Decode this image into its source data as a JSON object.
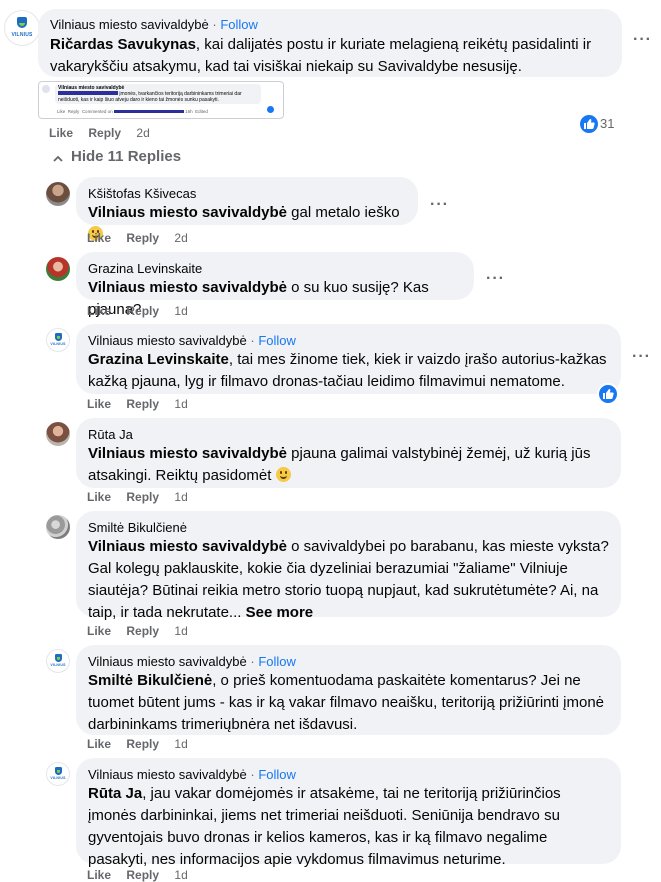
{
  "top_post": {
    "author": "Vilniaus miesto savivaldybė",
    "follow": "Follow",
    "separator": "·",
    "mention": "Ričardas Savukynas",
    "text": ", kai dalijatės postu ir kuriate melagieną reikėtų pasidalinti ir vakarykščiu atsakymu, kad tai visiškai niekaip su Savivaldybe nesusiję.",
    "avatar_brand": "VILNIUS",
    "actions": {
      "like": "Like",
      "reply": "Reply",
      "time": "2d"
    },
    "reaction_count": "31",
    "embedded_screenshot": {
      "author": "Vilniaus miesto savivaldybė",
      "line1": "įmonės, tvarkančios teritoriją darbininkams trimeriai dar",
      "line2": "neišduoti, kas ir kaip šiuo atveju daro ir kieno tai žmonės sunku pasakyti.",
      "like": "Like",
      "reply": "Reply",
      "commented_on": "Commented on",
      "time": "16h",
      "edited": "Edited"
    }
  },
  "hide_replies": "Hide 11 Replies",
  "replies": [
    {
      "author": "Kšištofas Kšivecas",
      "mention": "Vilniaus miesto savivaldybė",
      "text": " gal metalo ieško ",
      "emoji": "grin",
      "like": "Like",
      "reply": "Reply",
      "time": "2d"
    },
    {
      "author": "Grazina Levinskaite",
      "mention": "Vilniaus miesto savivaldybė",
      "text": " o su kuo susiję? Kas pjauna?",
      "like": "Like",
      "reply": "Reply",
      "time": "1d"
    },
    {
      "author": "Vilniaus miesto savivaldybė",
      "follow": "Follow",
      "mention": "Grazina Levinskaite",
      "text": ", tai mes žinome tiek, kiek ir vaizdo įrašo autorius-kažkas kažką pjauna, lyg ir filmavo dronas-tačiau leidimo filmavimui nematome.",
      "like": "Like",
      "reply": "Reply",
      "time": "1d"
    },
    {
      "author": "Rūta Ja",
      "mention": "Vilniaus miesto savivaldybė",
      "text": " pjauna galimai valstybinėj žemėj, už kurią jūs atsakingi. Reiktų pasidomėt ",
      "emoji": "smile",
      "like": "Like",
      "reply": "Reply",
      "time": "1d"
    },
    {
      "author": "Smiltė Bikulčienė",
      "mention": "Vilniaus miesto savivaldybė",
      "text": " o savivaldybei po barabanu, kas mieste vyksta? Gal kolegų paklauskite, kokie čia dyzeliniai berazumiai \"žaliame\" Vilniuje siautėja? Būtinai reikia metro storio tuopą nupjaut, kad sukrutėtumėte? Ai, na taip, ir tada nekrutate... ",
      "see_more": "See more",
      "like": "Like",
      "reply": "Reply",
      "time": "1d"
    },
    {
      "author": "Vilniaus miesto savivaldybė",
      "follow": "Follow",
      "mention": "Smiltė Bikulčienė",
      "text": ", o prieš komentuodama paskaitėte komentarus? Jei ne tuomet būtent jums - kas ir ką vakar filmavo neaišku, teritoriją prižiūrinti įmonė darbininkams trimeriųbnėra net išdavusi.",
      "like": "Like",
      "reply": "Reply",
      "time": "1d"
    },
    {
      "author": "Vilniaus miesto savivaldybė",
      "follow": "Follow",
      "mention": "Rūta Ja",
      "text": ", jau vakar domėjomės ir atsakėme, tai ne teritoriją prižiūrinčios įmonės darbininkai, jiems net trimeriai neišduoti. Seniūnija bendravo su gyventojais buvo dronas ir kelios kameros, kas ir ką filmavo negalime pasakyti, nes informacijos apie vykdomus filmavimus neturime.",
      "like": "Like",
      "reply": "Reply",
      "time": "1d"
    }
  ],
  "colors": {
    "bubble": "#f0f2f5",
    "link_blue": "#1877f2",
    "muted": "#65676b",
    "brand_blue": "#1e6bc4"
  }
}
